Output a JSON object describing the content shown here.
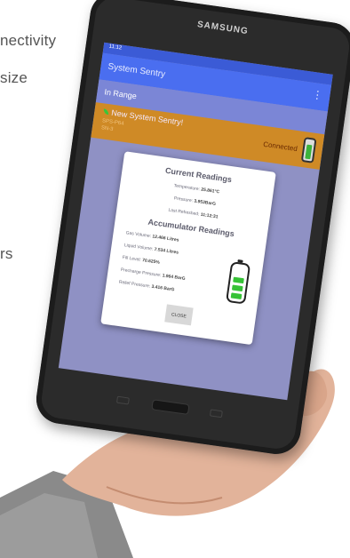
{
  "background": {
    "line1": "nectivity",
    "line2": "size",
    "line3": "rs"
  },
  "tablet": {
    "brand": "SAMSUNG",
    "status_time": "11:12",
    "app_title": "System Sentry",
    "menu_glyph": "⋮",
    "section_label": "In Range",
    "device": {
      "name": "New System Sentry!",
      "sub1": "SPS-P64",
      "sub2": "SN-3",
      "state": "Connected"
    },
    "dialog": {
      "current_heading": "Current Readings",
      "temperature_label": "Temperature:",
      "temperature_value": "25.861°C",
      "pressure_label": "Pressure:",
      "pressure_value": "3.953BarG",
      "refreshed_label": "Last Refreshed:",
      "refreshed_value": "11:12:31",
      "accumulator_heading": "Accumulator Readings",
      "gas_label": "Gas Volume:",
      "gas_value": "12.466 Litres",
      "liquid_label": "Liquid Volume:",
      "liquid_value": "7.534 Litres",
      "fill_label": "Fill Level:",
      "fill_value": "70.625%",
      "precharge_label": "Precharge Pressure:",
      "precharge_value": "1.964 BarG",
      "relief_label": "Relief Pressure:",
      "relief_value": "3.416 BarG",
      "close_label": "CLOSE",
      "battery_level": 0.75
    }
  },
  "colors": {
    "screen_bg": "#8f91c4",
    "appbar": "#4a6ef0",
    "device_row": "#cf8a26",
    "battery_green": "#36c236"
  }
}
